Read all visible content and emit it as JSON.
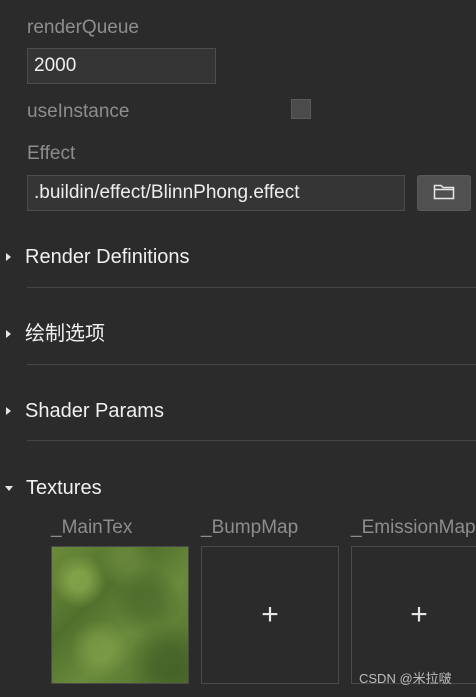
{
  "properties": {
    "render_queue": {
      "label": "renderQueue",
      "value": "2000"
    },
    "use_instance": {
      "label": "useInstance",
      "checked": false
    },
    "effect": {
      "label": "Effect",
      "value": ".buildin/effect/BlinnPhong.effect",
      "browse_icon": "folder-icon"
    }
  },
  "sections": [
    {
      "title": "Render Definitions",
      "expanded": false
    },
    {
      "title": "绘制选项",
      "expanded": false
    },
    {
      "title": "Shader Params",
      "expanded": false
    },
    {
      "title": "Textures",
      "expanded": true
    }
  ],
  "textures": [
    {
      "label": "_MainTex",
      "assigned": true
    },
    {
      "label": "_BumpMap",
      "assigned": false,
      "icon": "+"
    },
    {
      "label": "_EmissionMap",
      "assigned": false,
      "icon": "+"
    }
  ],
  "watermark": "CSDN @米拉啵",
  "colors": {
    "background": "#2b2b2b",
    "field": "#353535",
    "button": "#505050"
  }
}
